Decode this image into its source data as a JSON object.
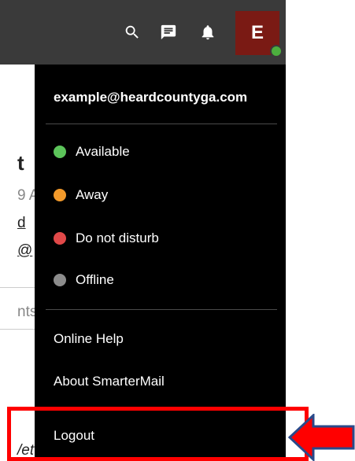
{
  "topbar": {
    "icons": [
      "search-icon",
      "chat-icon",
      "bell-icon"
    ],
    "avatar_letter": "E",
    "avatar_color": "#7a1a14",
    "status_color": "#4caf3e"
  },
  "background_page": {
    "fragment_1": "t",
    "fragment_2": "9 A",
    "fragment_3": "d",
    "fragment_4": "@",
    "fragment_5": "nts",
    "fragment_6": "/et"
  },
  "menu": {
    "email": "example@heardcountyga.com",
    "statuses": [
      {
        "label": "Available",
        "color": "#5cc45a"
      },
      {
        "label": "Away",
        "color": "#f39a2b"
      },
      {
        "label": "Do not disturb",
        "color": "#e04848"
      },
      {
        "label": "Offline",
        "color": "#8c8c8c"
      }
    ],
    "links": {
      "online_help": "Online Help",
      "about": "About SmarterMail",
      "logout": "Logout"
    }
  },
  "annotation": {
    "highlight_color": "#ff0000",
    "arrow_color": "#ff0000",
    "arrow_outline_color": "#2a4a8a"
  }
}
